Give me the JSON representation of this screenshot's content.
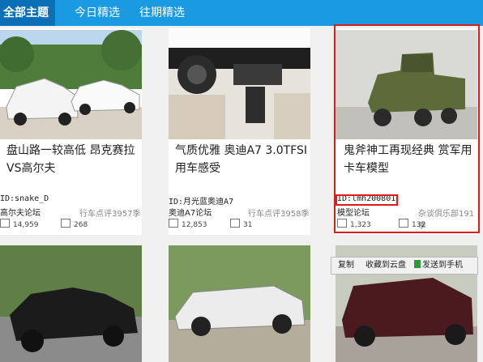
{
  "tabs": [
    {
      "label": "全部主题"
    },
    {
      "label": "今日精选"
    },
    {
      "label": "往期精选"
    }
  ],
  "cards": [
    {
      "title": "盘山路一较高低 昂克赛拉VS高尔夫",
      "stat": "行车点评3957季",
      "author": "ID:snake_D",
      "forum": "高尔夫论坛",
      "views": "14,959",
      "comments": "268"
    },
    {
      "title": "气质优雅 奥迪A7 3.0TFSI用车感受",
      "stat": "行车点评3958季",
      "author": "ID:月光蓝奥迪A7",
      "forum": "奥迪A7论坛",
      "views": "12,853",
      "comments": "31"
    },
    {
      "title": "鬼斧神工再现经典 赏军用卡车模型",
      "stat": "杂谈俱乐部191季",
      "author": "ID:lmh200801",
      "forum": "模型论坛",
      "views": "1,323",
      "comments": "132"
    }
  ],
  "toolbar": {
    "copy": "复制",
    "save_cloud": "收藏到云盘",
    "send_phone": "发送到手机"
  },
  "colors": {
    "topbar": "#1a9ae0",
    "active_tab": "#0b6fb5",
    "highlight": "#e01b1b"
  }
}
